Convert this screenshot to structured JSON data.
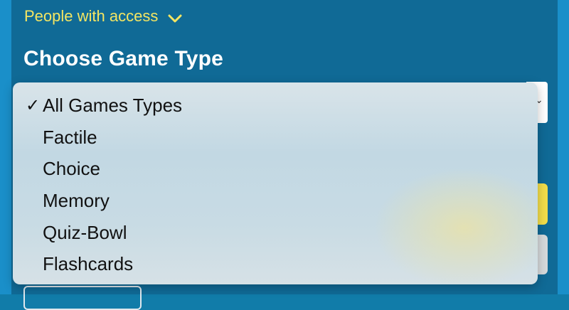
{
  "access": {
    "label": "People with access",
    "icon": "chevron-down-icon"
  },
  "section": {
    "title": "Choose Game Type"
  },
  "colors": {
    "background": "#106a96",
    "accent": "#f4e562",
    "dropdown": "#c8dbe4"
  },
  "dropdown": {
    "selected": "All Games Types",
    "options": [
      {
        "label": "All Games Types",
        "checked": true
      },
      {
        "label": "Factile"
      },
      {
        "label": "Choice"
      },
      {
        "label": "Memory"
      },
      {
        "label": "Quiz-Bowl"
      },
      {
        "label": "Flashcards"
      }
    ]
  }
}
